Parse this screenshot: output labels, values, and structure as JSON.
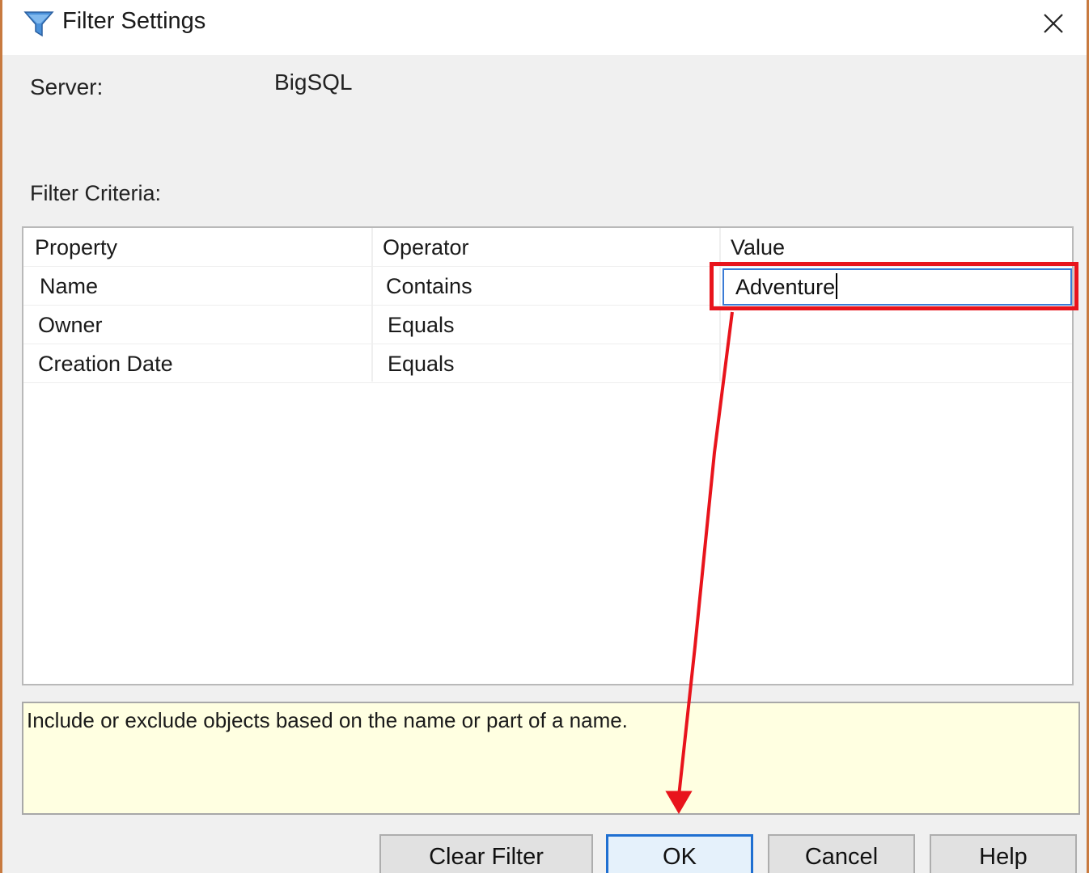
{
  "dialog": {
    "title": "Filter Settings",
    "icon": "filter-icon",
    "close_icon": "close-icon"
  },
  "server": {
    "label": "Server:",
    "value": "BigSQL"
  },
  "criteria": {
    "label": "Filter Criteria:",
    "columns": [
      "Property",
      "Operator",
      "Value"
    ],
    "rows": [
      {
        "property": "Name",
        "operator": "Contains",
        "value": "Adventure"
      },
      {
        "property": "Owner",
        "operator": "Equals",
        "value": ""
      },
      {
        "property": "Creation Date",
        "operator": "Equals",
        "value": ""
      }
    ]
  },
  "description": "Include or exclude objects based on the name or part of a name.",
  "buttons": {
    "clear_filter": "Clear Filter",
    "ok": "OK",
    "cancel": "Cancel",
    "help": "Help"
  },
  "colors": {
    "annotation": "#e8141c",
    "focus": "#1f6fd1",
    "description_bg": "#ffffe1"
  }
}
